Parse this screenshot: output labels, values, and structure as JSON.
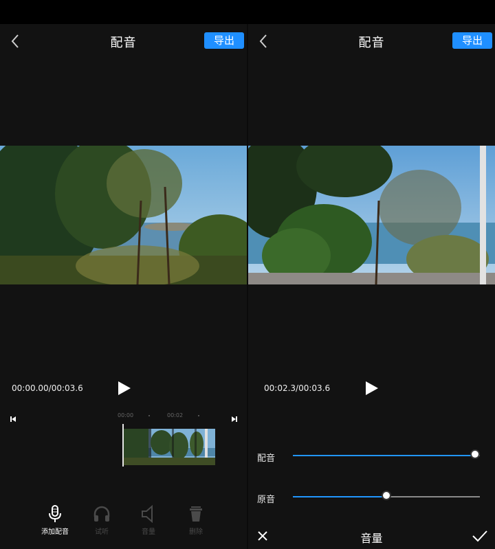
{
  "left": {
    "header": {
      "title": "配音",
      "export_label": "导出"
    },
    "player": {
      "time": "00:00.00/00:03.6"
    },
    "timeline": {
      "marks": [
        "00:00",
        "00:02"
      ]
    },
    "tools": [
      {
        "label": "添加配音",
        "icon": "microphone-icon"
      },
      {
        "label": "试听",
        "icon": "headphones-icon"
      },
      {
        "label": "音量",
        "icon": "speaker-icon"
      },
      {
        "label": "删除",
        "icon": "trash-icon"
      }
    ]
  },
  "right": {
    "header": {
      "title": "配音",
      "export_label": "导出"
    },
    "player": {
      "time": "00:02.3/00:03.6"
    },
    "volume": {
      "dub_label": "配音",
      "dub_level": 1.0,
      "original_label": "原音",
      "original_level": 0.5
    },
    "bottom": {
      "title": "音量"
    }
  },
  "colors": {
    "accent": "#1f8fff",
    "background": "#121212"
  }
}
